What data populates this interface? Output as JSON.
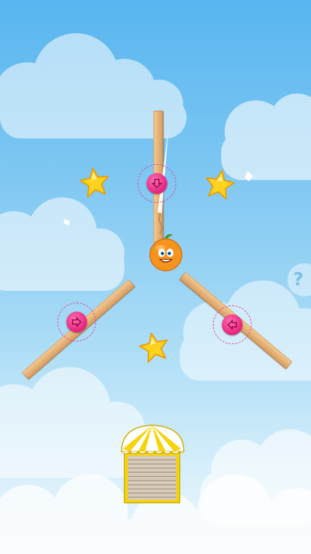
{
  "game": {
    "help_button_label": "?",
    "stars": [
      {
        "name": "star-left",
        "collected": false
      },
      {
        "name": "star-right",
        "collected": false
      },
      {
        "name": "star-bottom",
        "collected": false
      }
    ],
    "pins": [
      {
        "name": "pin-center",
        "arrow": "down"
      },
      {
        "name": "pin-left",
        "arrow": "right"
      },
      {
        "name": "pin-right",
        "arrow": "left"
      }
    ],
    "colors": {
      "sky_top": "#58b6f0",
      "sky_bottom": "#eef8fd",
      "pin": "#e92b84",
      "star": "#ffd21f",
      "fruit": "#f7941d",
      "plank": "#e6b37a",
      "box_stripe": "#f6d40a"
    },
    "icons": [
      "arrow-down-icon",
      "arrow-right-icon",
      "arrow-left-icon",
      "question-icon",
      "star-icon"
    ]
  }
}
